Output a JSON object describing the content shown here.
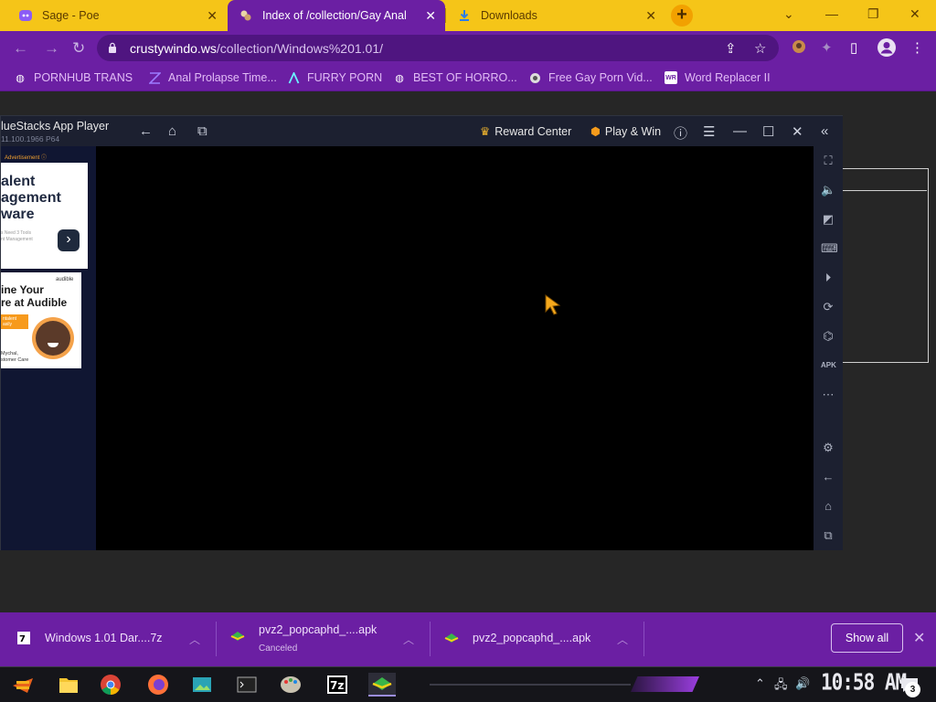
{
  "browser": {
    "tabs": [
      {
        "title": "Sage - Poe",
        "icon": "poe-icon",
        "active": false
      },
      {
        "title": "Index of /collection/Gay Anal",
        "icon": "site-icon",
        "active": true
      },
      {
        "title": "Downloads",
        "icon": "download-icon",
        "active": false
      }
    ],
    "url_domain": "crustywindo.ws",
    "url_path": "/collection/Windows%201.01/",
    "accent": "#6b1fa3",
    "tab_strip_color": "#f5c518"
  },
  "bookmarks": [
    {
      "label": "PORNHUB TRANS",
      "icon": "globe-icon"
    },
    {
      "label": "Anal Prolapse Time...",
      "icon": "bookmark-icon"
    },
    {
      "label": "FURRY PORN",
      "icon": "arrow-logo-icon"
    },
    {
      "label": "BEST OF HORRO...",
      "icon": "globe-icon"
    },
    {
      "label": "Free Gay Porn Vid...",
      "icon": "site-icon"
    },
    {
      "label": "Word Replacer II",
      "icon": "wr-icon"
    }
  ],
  "bluestacks": {
    "app_name": "lueStacks App Player",
    "version": "11.100.1966  P64",
    "reward_center": "Reward Center",
    "play_win": "Play & Win",
    "ad_label": "Advertisement ⓘ",
    "ad1_text": "alent\nagement\nware",
    "ad1_small": "s Need 3 Tools\nnt Management",
    "ad2_brand": "audible",
    "ad2_text": "ine Your\nre at Audible",
    "ad2_tag": "ntalent\nasily",
    "ad2_name": "Mychal,\nstomer Care"
  },
  "downloads": [
    {
      "name": "Windows 1.01 Dar....7z",
      "status": "",
      "icon": "7z-file-icon"
    },
    {
      "name": "pvz2_popcaphd_....apk",
      "status": "Canceled",
      "icon": "bluestacks-apk-icon"
    },
    {
      "name": "pvz2_popcaphd_....apk",
      "status": "",
      "icon": "bluestacks-apk-icon"
    }
  ],
  "show_all": "Show all",
  "taskbar": {
    "clock": "10:58 AM",
    "notification_count": "3"
  }
}
